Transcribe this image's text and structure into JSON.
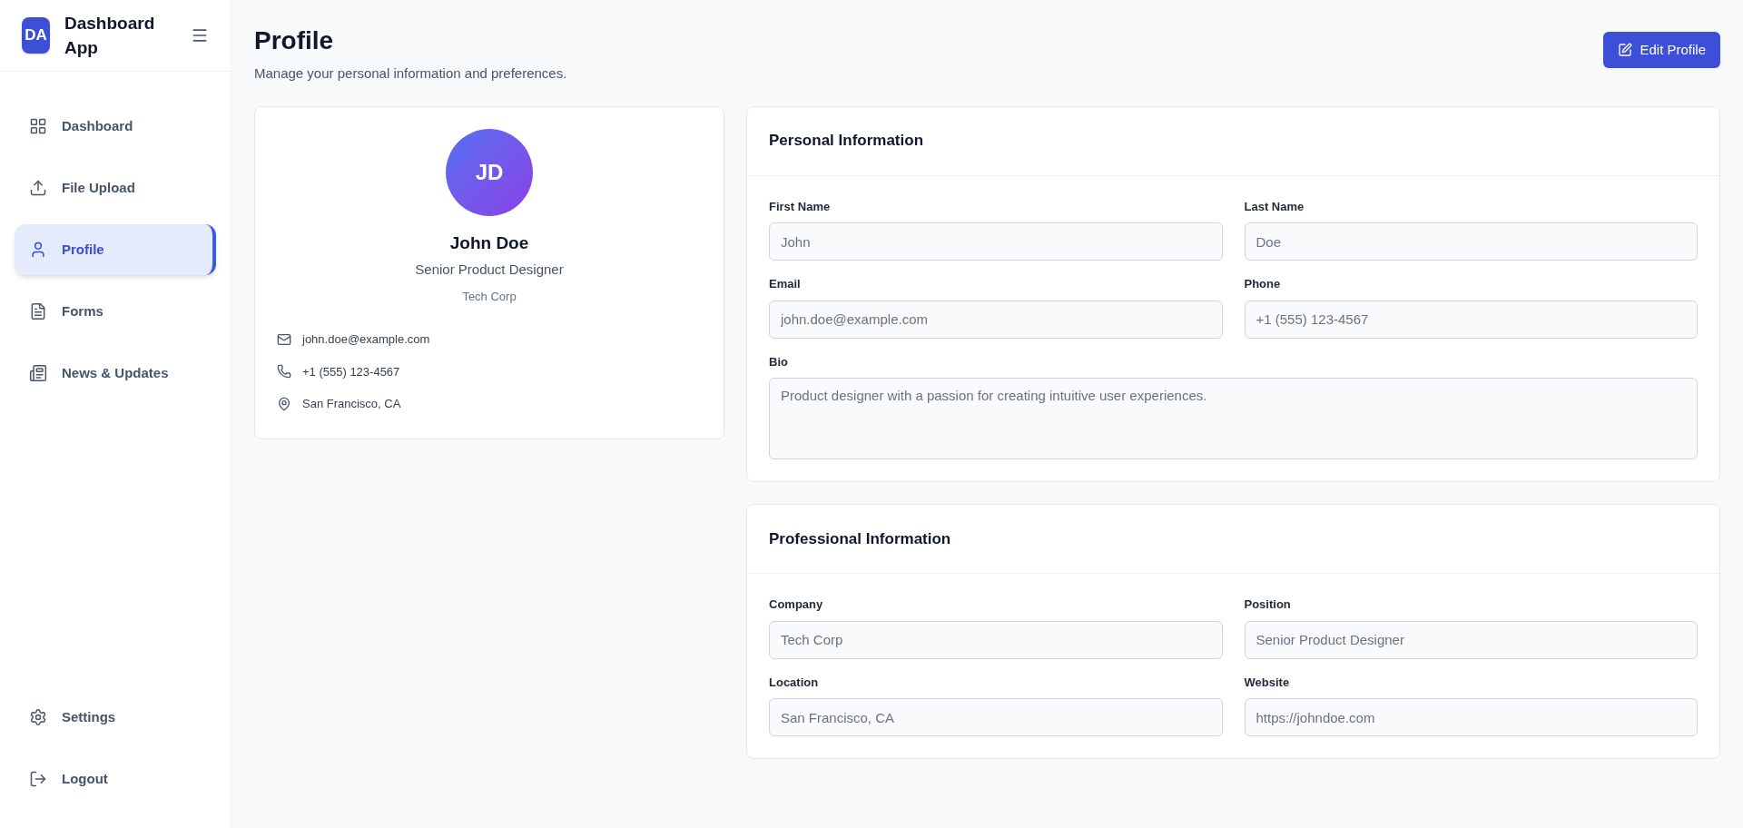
{
  "sidebar": {
    "logo": "DA",
    "app_name": "Dashboard App",
    "items": [
      {
        "label": "Dashboard",
        "kind": "dashboard",
        "selected": false
      },
      {
        "label": "File Upload",
        "kind": "upload",
        "selected": false
      },
      {
        "label": "Profile",
        "kind": "profile",
        "selected": true
      },
      {
        "label": "Forms",
        "kind": "forms",
        "selected": false
      },
      {
        "label": "News & Updates",
        "kind": "news",
        "selected": false
      }
    ],
    "bottom_items": [
      {
        "label": "Settings",
        "kind": "settings"
      },
      {
        "label": "Logout",
        "kind": "logout"
      }
    ]
  },
  "header": {
    "title": "Profile",
    "subtitle": "Manage your personal information and preferences.",
    "button": "Edit Profile"
  },
  "profile_card": {
    "initials": "JD",
    "name": "John Doe",
    "role": "Senior Product Designer",
    "company": "Tech Corp",
    "contacts": [
      {
        "kind": "email",
        "text": "john.doe@example.com"
      },
      {
        "kind": "phone",
        "text": "+1 (555) 123-4567"
      },
      {
        "kind": "location",
        "text": "San Francisco, CA"
      }
    ]
  },
  "sections": [
    {
      "title": "Personal Information",
      "fields": [
        {
          "label": "First Name",
          "value": "John",
          "kind": "input",
          "disabled": true
        },
        {
          "label": "Last Name",
          "value": "Doe",
          "kind": "input",
          "disabled": true
        },
        {
          "label": "Email",
          "value": "john.doe@example.com",
          "kind": "input",
          "disabled": true
        },
        {
          "label": "Phone",
          "value": "+1 (555) 123-4567",
          "kind": "input",
          "disabled": true
        },
        {
          "label": "Bio",
          "value": "Product designer with a passion for creating intuitive user experiences.",
          "kind": "textarea",
          "disabled": true
        }
      ]
    },
    {
      "title": "Professional Information",
      "fields": [
        {
          "label": "Company",
          "value": "Tech Corp",
          "kind": "input",
          "disabled": true
        },
        {
          "label": "Position",
          "value": "Senior Product Designer",
          "kind": "input",
          "disabled": true
        },
        {
          "label": "Location",
          "value": "San Francisco, CA",
          "kind": "input",
          "disabled": true
        },
        {
          "label": "Website",
          "value": "https://johndoe.com",
          "kind": "input",
          "disabled": true
        }
      ]
    }
  ]
}
